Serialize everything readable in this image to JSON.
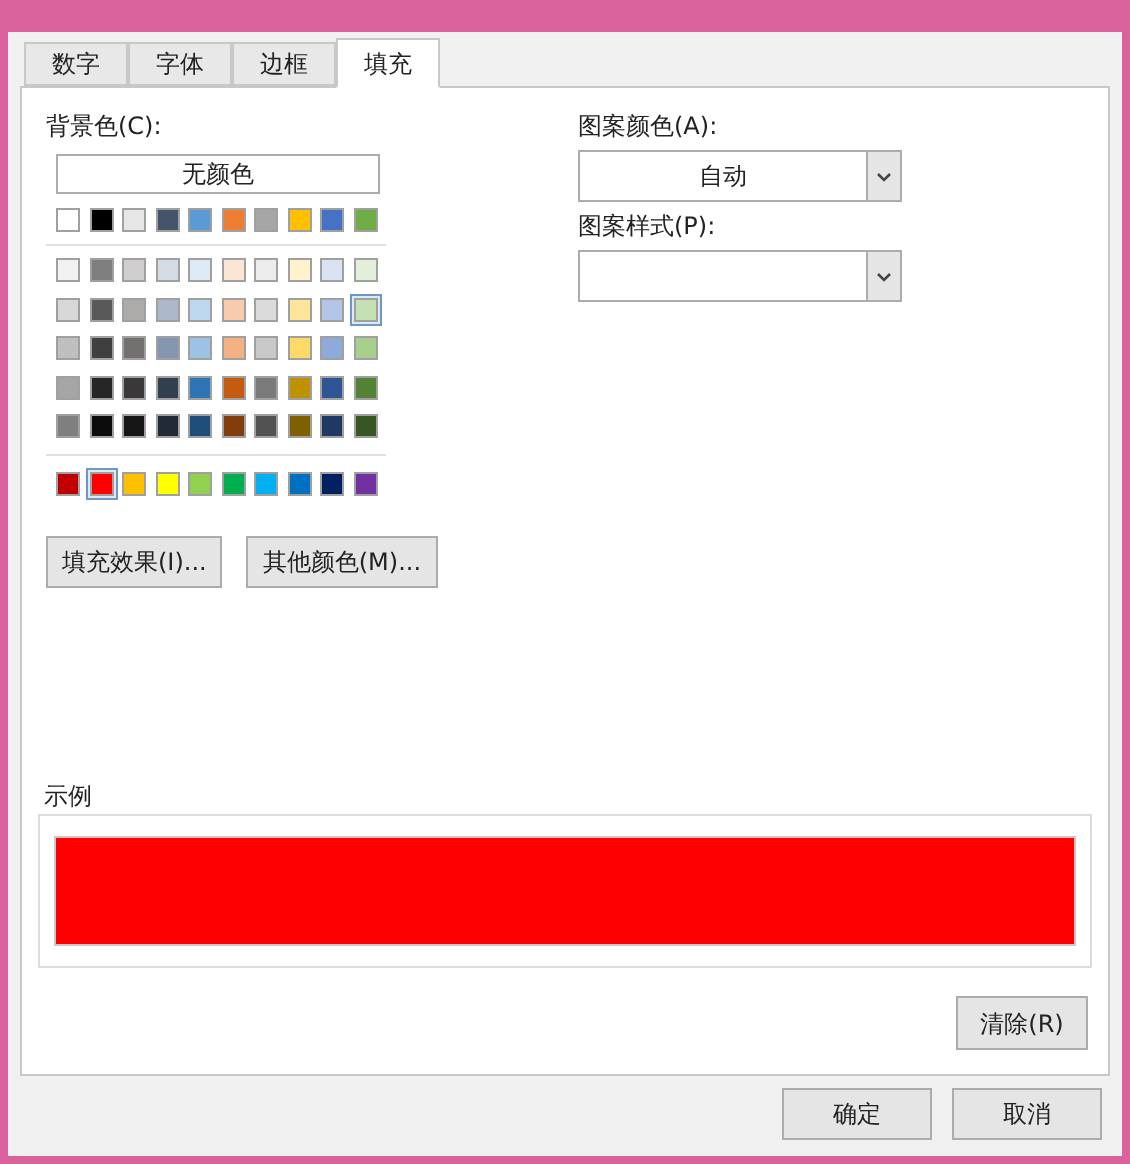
{
  "tabs": [
    {
      "label": "数字",
      "selected": false
    },
    {
      "label": "字体",
      "selected": false
    },
    {
      "label": "边框",
      "selected": false
    },
    {
      "label": "填充",
      "selected": true
    }
  ],
  "background_color": {
    "label": "背景色(C):",
    "no_color_button": "无颜色",
    "theme_colors": [
      {
        "color": "#ffffff",
        "selected": false
      },
      {
        "color": "#000000",
        "selected": false
      },
      {
        "color": "#e7e6e6",
        "selected": false
      },
      {
        "color": "#44546a",
        "selected": false
      },
      {
        "color": "#5b9bd5",
        "selected": false
      },
      {
        "color": "#ed7d31",
        "selected": false
      },
      {
        "color": "#a5a5a5",
        "selected": false
      },
      {
        "color": "#ffc000",
        "selected": false
      },
      {
        "color": "#4472c4",
        "selected": false
      },
      {
        "color": "#70ad47",
        "selected": false
      }
    ],
    "tint_rows": [
      [
        {
          "color": "#f2f2f2",
          "selected": false
        },
        {
          "color": "#7f7f7f",
          "selected": false
        },
        {
          "color": "#d0cece",
          "selected": false
        },
        {
          "color": "#d6dce4",
          "selected": false
        },
        {
          "color": "#deebf6",
          "selected": false
        },
        {
          "color": "#fbe5d5",
          "selected": false
        },
        {
          "color": "#ededed",
          "selected": false
        },
        {
          "color": "#fff2cc",
          "selected": false
        },
        {
          "color": "#dae3f3",
          "selected": false
        },
        {
          "color": "#e2efd9",
          "selected": false
        }
      ],
      [
        {
          "color": "#d8d8d8",
          "selected": false
        },
        {
          "color": "#595959",
          "selected": false
        },
        {
          "color": "#aeabab",
          "selected": false
        },
        {
          "color": "#adb9ca",
          "selected": false
        },
        {
          "color": "#bdd7ee",
          "selected": false
        },
        {
          "color": "#f7cbac",
          "selected": false
        },
        {
          "color": "#dbdbdb",
          "selected": false
        },
        {
          "color": "#fee599",
          "selected": false
        },
        {
          "color": "#b4c6e7",
          "selected": false
        },
        {
          "color": "#c5e0b3",
          "selected": true
        }
      ],
      [
        {
          "color": "#bfbfbf",
          "selected": false
        },
        {
          "color": "#3f3f3f",
          "selected": false
        },
        {
          "color": "#757070",
          "selected": false
        },
        {
          "color": "#8496b0",
          "selected": false
        },
        {
          "color": "#9cc3e5",
          "selected": false
        },
        {
          "color": "#f4b183",
          "selected": false
        },
        {
          "color": "#c9c9c9",
          "selected": false
        },
        {
          "color": "#ffd965",
          "selected": false
        },
        {
          "color": "#8eaadb",
          "selected": false
        },
        {
          "color": "#a8d08d",
          "selected": false
        }
      ],
      [
        {
          "color": "#a5a5a5",
          "selected": false
        },
        {
          "color": "#262626",
          "selected": false
        },
        {
          "color": "#3a3838",
          "selected": false
        },
        {
          "color": "#323f4f",
          "selected": false
        },
        {
          "color": "#2e75b5",
          "selected": false
        },
        {
          "color": "#c55a11",
          "selected": false
        },
        {
          "color": "#7b7b7b",
          "selected": false
        },
        {
          "color": "#bf9000",
          "selected": false
        },
        {
          "color": "#2f5496",
          "selected": false
        },
        {
          "color": "#538135",
          "selected": false
        }
      ],
      [
        {
          "color": "#7f7f7f",
          "selected": false
        },
        {
          "color": "#0c0c0c",
          "selected": false
        },
        {
          "color": "#171616",
          "selected": false
        },
        {
          "color": "#222a35",
          "selected": false
        },
        {
          "color": "#1e4e79",
          "selected": false
        },
        {
          "color": "#833c0b",
          "selected": false
        },
        {
          "color": "#525252",
          "selected": false
        },
        {
          "color": "#7f6000",
          "selected": false
        },
        {
          "color": "#1f3864",
          "selected": false
        },
        {
          "color": "#375623",
          "selected": false
        }
      ]
    ],
    "standard_colors": [
      {
        "color": "#c00000",
        "selected": false
      },
      {
        "color": "#ff0000",
        "selected": true
      },
      {
        "color": "#ffc000",
        "selected": false
      },
      {
        "color": "#ffff00",
        "selected": false
      },
      {
        "color": "#92d050",
        "selected": false
      },
      {
        "color": "#00b050",
        "selected": false
      },
      {
        "color": "#00b0f0",
        "selected": false
      },
      {
        "color": "#0070c0",
        "selected": false
      },
      {
        "color": "#002060",
        "selected": false
      },
      {
        "color": "#7030a0",
        "selected": false
      }
    ],
    "buttons": [
      "填充效果(I)...",
      "其他颜色(M)..."
    ]
  },
  "pattern_color": {
    "label": "图案颜色(A):",
    "value": "自动"
  },
  "pattern_style": {
    "label": "图案样式(P):"
  },
  "sample": {
    "label": "示例",
    "color": "#ff0000"
  },
  "clear_button": "清除(R)",
  "footer_buttons": [
    "确定",
    "取消"
  ]
}
